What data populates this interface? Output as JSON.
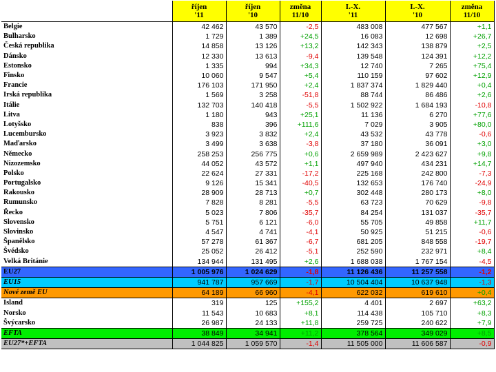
{
  "headers": [
    {
      "line1": "říjen",
      "line2": "'11"
    },
    {
      "line1": "říjen",
      "line2": "'10"
    },
    {
      "line1": "změna",
      "line2": "11/10"
    },
    {
      "line1": "I.-X.",
      "line2": "'11"
    },
    {
      "line1": "I.-X.",
      "line2": "'10"
    },
    {
      "line1": "změna",
      "line2": "11/10"
    }
  ],
  "countries": [
    {
      "name": "Belgie",
      "v": [
        "42 462",
        "43 570",
        "-2,5",
        "483 008",
        "477 567",
        "+1,1"
      ]
    },
    {
      "name": "Bulharsko",
      "v": [
        "1 729",
        "1 389",
        "+24,5",
        "16 083",
        "12 698",
        "+26,7"
      ]
    },
    {
      "name": "Česká republika",
      "v": [
        "14 858",
        "13 126",
        "+13,2",
        "142 343",
        "138 879",
        "+2,5"
      ]
    },
    {
      "name": "Dánsko",
      "v": [
        "12 330",
        "13 613",
        "-9,4",
        "139 548",
        "124 391",
        "+12,2"
      ]
    },
    {
      "name": "Estonsko",
      "v": [
        "1 335",
        "994",
        "+34,3",
        "12 740",
        "7 265",
        "+75,4"
      ]
    },
    {
      "name": "Finsko",
      "v": [
        "10 060",
        "9 547",
        "+5,4",
        "110 159",
        "97 602",
        "+12,9"
      ]
    },
    {
      "name": "Francie",
      "v": [
        "176 103",
        "171 950",
        "+2,4",
        "1 837 374",
        "1 829 440",
        "+0,4"
      ]
    },
    {
      "name": "Irská republika",
      "v": [
        "1 569",
        "3 258",
        "-51,8",
        "88 744",
        "86 486",
        "+2,6"
      ]
    },
    {
      "name": "Itálie",
      "v": [
        "132 703",
        "140 418",
        "-5,5",
        "1 502 922",
        "1 684 193",
        "-10,8"
      ]
    },
    {
      "name": "Litva",
      "v": [
        "1 180",
        "943",
        "+25,1",
        "11 136",
        "6 270",
        "+77,6"
      ]
    },
    {
      "name": "Lotyšsko",
      "v": [
        "838",
        "396",
        "+111,6",
        "7 029",
        "3 905",
        "+80,0"
      ]
    },
    {
      "name": "Lucembursko",
      "v": [
        "3 923",
        "3 832",
        "+2,4",
        "43 532",
        "43 778",
        "-0,6"
      ]
    },
    {
      "name": "Maďarsko",
      "v": [
        "3 499",
        "3 638",
        "-3,8",
        "37 180",
        "36 091",
        "+3,0"
      ]
    },
    {
      "name": "Německo",
      "v": [
        "258 253",
        "256 775",
        "+0,6",
        "2 659 989",
        "2 423 627",
        "+9,8"
      ]
    },
    {
      "name": "Nizozemsko",
      "v": [
        "44 052",
        "43 572",
        "+1,1",
        "497 940",
        "434 231",
        "+14,7"
      ]
    },
    {
      "name": "Polsko",
      "v": [
        "22 624",
        "27 331",
        "-17,2",
        "225 168",
        "242 800",
        "-7,3"
      ]
    },
    {
      "name": "Portugalsko",
      "v": [
        "9 126",
        "15 341",
        "-40,5",
        "132 653",
        "176 740",
        "-24,9"
      ]
    },
    {
      "name": "Rakousko",
      "v": [
        "28 909",
        "28 713",
        "+0,7",
        "302 448",
        "280 173",
        "+8,0"
      ]
    },
    {
      "name": "Rumunsko",
      "v": [
        "7 828",
        "8 281",
        "-5,5",
        "63 723",
        "70 629",
        "-9,8"
      ]
    },
    {
      "name": "Řecko",
      "v": [
        "5 023",
        "7 806",
        "-35,7",
        "84 254",
        "131 037",
        "-35,7"
      ]
    },
    {
      "name": "Slovensko",
      "v": [
        "5 751",
        "6 121",
        "-6,0",
        "55 705",
        "49 858",
        "+11,7"
      ]
    },
    {
      "name": "Slovinsko",
      "v": [
        "4 547",
        "4 741",
        "-4,1",
        "50 925",
        "51 215",
        "-0,6"
      ]
    },
    {
      "name": "Španělsko",
      "v": [
        "57 278",
        "61 367",
        "-6,7",
        "681 205",
        "848 558",
        "-19,7"
      ]
    },
    {
      "name": "Švédsko",
      "v": [
        "25 052",
        "26 412",
        "-5,1",
        "252 590",
        "232 971",
        "+8,4"
      ]
    },
    {
      "name": "Velká Británie",
      "v": [
        "134 944",
        "131 495",
        "+2,6",
        "1 688 038",
        "1 767 154",
        "-4,5"
      ]
    }
  ],
  "eu27": {
    "name": "EU27",
    "v": [
      "1 005 976",
      "1 024 629",
      "-1,8",
      "11 126 436",
      "11 257 558",
      "-1,2"
    ]
  },
  "eu15": {
    "name": "EU15",
    "v": [
      "941 787",
      "957 669",
      "-1,7",
      "10 504 404",
      "10 637 948",
      "-1,3"
    ]
  },
  "new_members": {
    "name": "Nové země EU",
    "v": [
      "64 189",
      "66 960",
      "-4,1",
      "622 032",
      "619 610",
      "+0,4"
    ]
  },
  "efta_countries": [
    {
      "name": "Island",
      "v": [
        "319",
        "125",
        "+155,2",
        "4 401",
        "2 697",
        "+63,2"
      ]
    },
    {
      "name": "Norsko",
      "v": [
        "11 543",
        "10 683",
        "+8,1",
        "114 438",
        "105 710",
        "+8,3"
      ]
    },
    {
      "name": "Švýcarsko",
      "v": [
        "26 987",
        "24 133",
        "+11,8",
        "259 725",
        "240 622",
        "+7,9"
      ]
    }
  ],
  "efta": {
    "name": "EFTA",
    "v": [
      "38 849",
      "34 941",
      "+11,2",
      "378 564",
      "349 029",
      "+8,5"
    ]
  },
  "total": {
    "name": "EU27*+EFTA",
    "v": [
      "1 044 825",
      "1 059 570",
      "-1,4",
      "11 505 000",
      "11 606 587",
      "-0,9"
    ]
  },
  "colors": {
    "header_bg": "#ffff00",
    "eu27_bg": "#3366ff",
    "eu15_bg": "#00ccff",
    "new_members_bg": "#ff9900",
    "efta_bg": "#00ee00",
    "total_bg": "#c0c0c0",
    "positive": "#00a000",
    "negative": "#e00000"
  }
}
